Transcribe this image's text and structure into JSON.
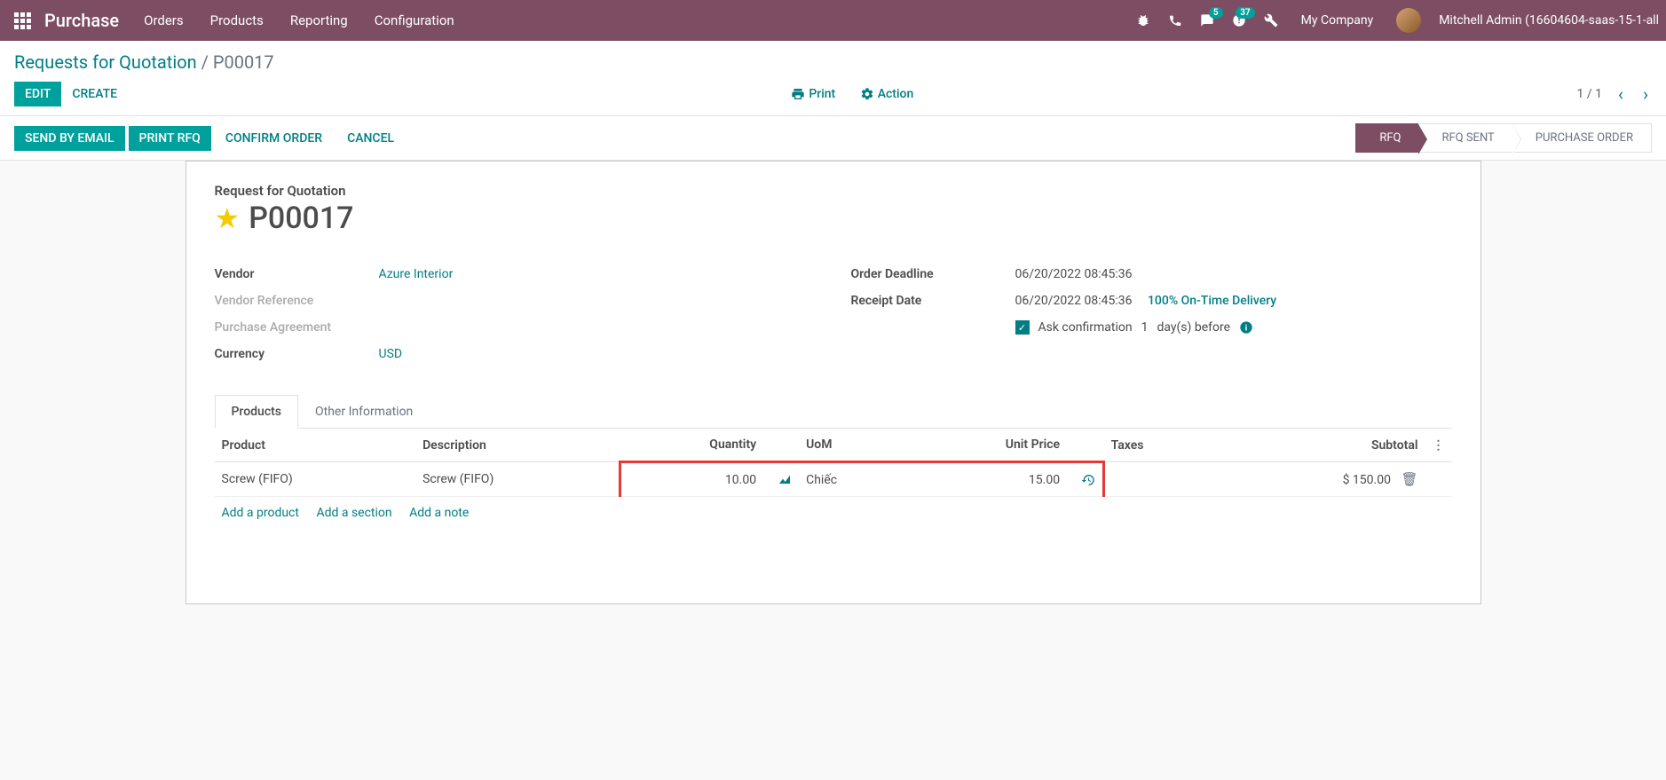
{
  "nav": {
    "brand": "Purchase",
    "menu": [
      "Orders",
      "Products",
      "Reporting",
      "Configuration"
    ],
    "msg_badge": "5",
    "activity_badge": "37",
    "company": "My Company",
    "user": "Mitchell Admin (16604604-saas-15-1-all"
  },
  "breadcrumb": {
    "parent": "Requests for Quotation",
    "current": "P00017"
  },
  "cp": {
    "edit": "Edit",
    "create": "Create",
    "print": "Print",
    "action": "Action",
    "pager": "1 / 1"
  },
  "statusbar": {
    "send_email": "Send by Email",
    "print_rfq": "Print RFQ",
    "confirm": "Confirm Order",
    "cancel": "Cancel",
    "steps": [
      "RFQ",
      "RFQ Sent",
      "Purchase Order"
    ]
  },
  "form": {
    "title_label": "Request for Quotation",
    "name": "P00017",
    "vendor_label": "Vendor",
    "vendor": "Azure Interior",
    "vendor_ref_label": "Vendor Reference",
    "agreement_label": "Purchase Agreement",
    "currency_label": "Currency",
    "currency": "USD",
    "deadline_label": "Order Deadline",
    "deadline": "06/20/2022 08:45:36",
    "receipt_label": "Receipt Date",
    "receipt": "06/20/2022 08:45:36",
    "on_time": "100% On-Time Delivery",
    "ask_confirm_prefix": "Ask confirmation",
    "ask_confirm_days": "1",
    "ask_confirm_suffix": "day(s) before"
  },
  "tabs": {
    "products": "Products",
    "other": "Other Information"
  },
  "table": {
    "headers": {
      "product": "Product",
      "description": "Description",
      "qty": "Quantity",
      "uom": "UoM",
      "price": "Unit Price",
      "taxes": "Taxes",
      "subtotal": "Subtotal"
    },
    "row": {
      "product": "Screw (FIFO)",
      "description": "Screw (FIFO)",
      "qty": "10.00",
      "uom": "Chiếc",
      "price": "15.00",
      "subtotal": "$ 150.00"
    },
    "add_product": "Add a product",
    "add_section": "Add a section",
    "add_note": "Add a note"
  }
}
